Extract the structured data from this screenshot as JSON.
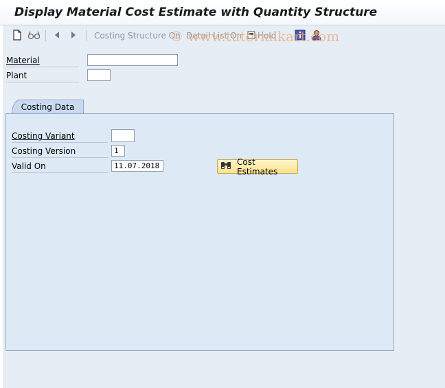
{
  "title": "Display Material Cost Estimate with Quantity Structure",
  "toolbar": {
    "costing_structure_label": "Costing Structure On",
    "detail_list_label": "Detail List On",
    "hold_label": "Hold",
    "icons": [
      "new-document-icon",
      "glasses-icon",
      "back-arrow-icon",
      "forward-arrow-icon",
      "info-icon",
      "user-icon"
    ]
  },
  "watermark": "© www.tutorialkart.com",
  "header_fields": {
    "material": {
      "label": "Material",
      "value": ""
    },
    "plant": {
      "label": "Plant",
      "value": ""
    }
  },
  "tabs": [
    {
      "label": "Costing Data",
      "active": true
    }
  ],
  "costing_data": {
    "costing_variant": {
      "label": "Costing Variant",
      "value": ""
    },
    "costing_version": {
      "label": "Costing Version",
      "value": "1"
    },
    "valid_on": {
      "label": "Valid On",
      "value": "11.07.2018"
    },
    "cost_estimates_button": "Cost Estimates"
  },
  "colors": {
    "background": "#e6edf5",
    "panel": "#dde9f4",
    "button_fill": "#fbe28d",
    "disabled_text": "#8a97a6",
    "watermark": "#f0a874"
  }
}
